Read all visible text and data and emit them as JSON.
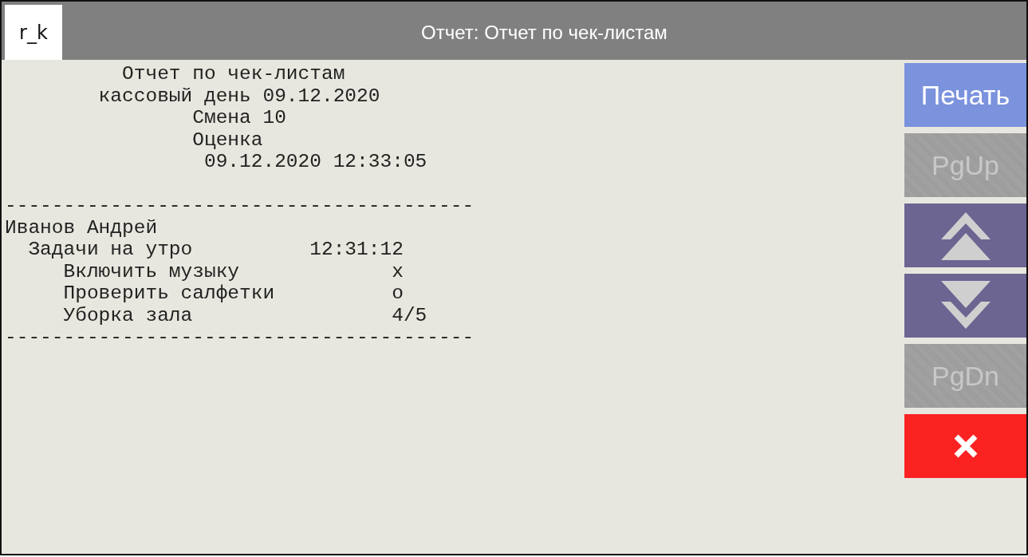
{
  "header": {
    "logo": "r_k",
    "title": "Отчет: Отчет по чек-листам"
  },
  "report": {
    "heading": [
      "          Отчет по чек-листам",
      "        кассовый день 09.12.2020",
      "                Смена 10",
      "                Оценка",
      "                 09.12.2020 12:33:05"
    ],
    "lines": [
      "----------------------------------------",
      "Иванов Андрей",
      "  Задачи на утро          12:31:12",
      "     Включить музыку             x",
      "     Проверить салфетки          o",
      "     Уборка зала                 4/5",
      "----------------------------------------"
    ]
  },
  "buttons": [
    {
      "kind": "text",
      "label": "Печать",
      "disabled": false
    },
    {
      "kind": "text",
      "label": "PgUp",
      "disabled": true
    },
    {
      "kind": "up",
      "disabled": false
    },
    {
      "kind": "down",
      "disabled": false
    },
    {
      "kind": "text",
      "label": "PgDn",
      "disabled": true
    },
    {
      "kind": "close",
      "disabled": false
    }
  ]
}
